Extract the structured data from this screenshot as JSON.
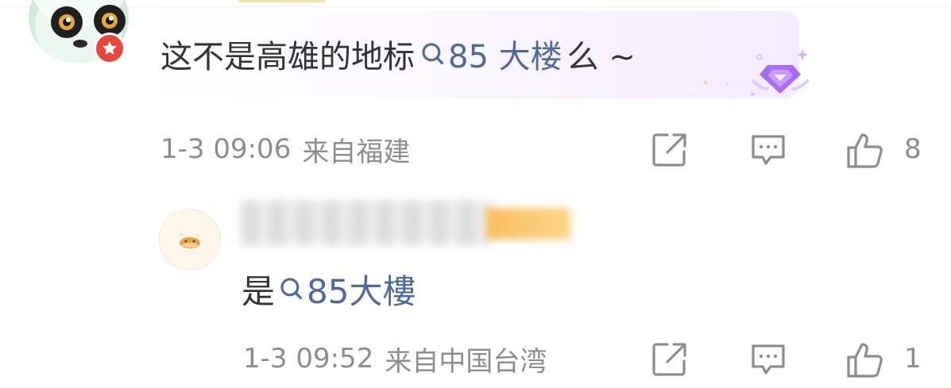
{
  "comment": {
    "prefix": "这不是高雄的地标",
    "topic": "85 大楼",
    "suffix": " 么 ~",
    "time": "1-3 09:06",
    "location": "来自福建",
    "likes": "8"
  },
  "reply": {
    "prefix": "是",
    "topic": "85大樓",
    "time": "1-3 09:52",
    "location": "来自中国台湾",
    "likes": "1"
  },
  "icons": {
    "share": "share-icon",
    "comment": "comment-icon",
    "like": "thumb-up-icon",
    "search": "search-icon",
    "gem": "diamond-badge-icon"
  },
  "colors": {
    "topic_link": "#4e6a9a",
    "meta_text": "#8d8d8d",
    "badge_red": "#e8483b",
    "gem_purple": "#a76df0"
  }
}
